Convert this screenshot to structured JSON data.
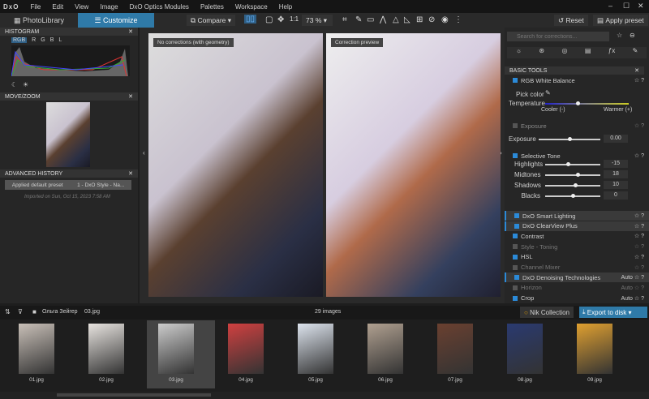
{
  "menu": {
    "logo": "DxO",
    "items": [
      "File",
      "Edit",
      "View",
      "Image",
      "DxO Optics Modules",
      "Palettes",
      "Workspace",
      "Help"
    ]
  },
  "toolbar": {
    "photolibrary": "PhotoLibrary",
    "customize": "Customize",
    "compare": "Compare",
    "one_to_one": "1:1",
    "zoom": "73 %",
    "reset": "Reset",
    "apply_preset": "Apply preset"
  },
  "histogram": {
    "title": "HISTOGRAM",
    "channels": [
      "RGB",
      "R",
      "G",
      "B",
      "L"
    ]
  },
  "movezoom": {
    "title": "MOVE/ZOOM"
  },
  "history": {
    "title": "ADVANCED HISTORY",
    "entry_action": "Applied default preset",
    "entry_value": "1 - DxO Style - Na...",
    "imported": "Imported on Sun, Oct 15, 2023 7:58 AM"
  },
  "viewer": {
    "left_label": "No corrections (with geometry)",
    "right_label": "Correction preview"
  },
  "right": {
    "search_placeholder": "Search for corrections...",
    "section": "BASIC TOOLS",
    "wb": {
      "title": "RGB White Balance",
      "pick": "Pick color",
      "temp": "Temperature",
      "cooler": "Cooler (-)",
      "warmer": "Warmer (+)"
    },
    "exposure": {
      "title": "Exposure",
      "label": "Exposure",
      "value": "0.00"
    },
    "tone": {
      "title": "Selective Tone",
      "sliders": [
        {
          "label": "Highlights",
          "value": "-15",
          "pos": 0.4
        },
        {
          "label": "Midtones",
          "value": "18",
          "pos": 0.6
        },
        {
          "label": "Shadows",
          "value": "10",
          "pos": 0.55
        },
        {
          "label": "Blacks",
          "value": "0",
          "pos": 0.5
        }
      ]
    },
    "tools": [
      {
        "label": "DxO Smart Lighting",
        "end": "",
        "on": true,
        "hl": true
      },
      {
        "label": "DxO ClearView Plus",
        "end": "",
        "on": true,
        "hl": true
      },
      {
        "label": "Contrast",
        "end": "",
        "on": true
      },
      {
        "label": "Style - Toning",
        "end": "",
        "on": false
      },
      {
        "label": "HSL",
        "end": "",
        "on": true
      },
      {
        "label": "Channel Mixer",
        "end": "",
        "on": false
      },
      {
        "label": "DxO Denoising Technologies",
        "end": "Auto",
        "on": true,
        "hl": true
      },
      {
        "label": "Horizon",
        "end": "Auto",
        "on": false
      },
      {
        "label": "Crop",
        "end": "Auto",
        "on": true
      }
    ]
  },
  "filmstrip": {
    "folder": "Ольга Зейгер",
    "file": "03.jpg",
    "count": "29 images",
    "nik": "Nik Collection",
    "export": "Export to disk",
    "thumbs": [
      "01.jpg",
      "02.jpg",
      "03.jpg",
      "04.jpg",
      "05.jpg",
      "06.jpg",
      "07.jpg",
      "08.jpg",
      "09.jpg"
    ]
  },
  "colors": {
    "accent": "#2f7aa8",
    "checkbox": "#2b8ad8"
  }
}
